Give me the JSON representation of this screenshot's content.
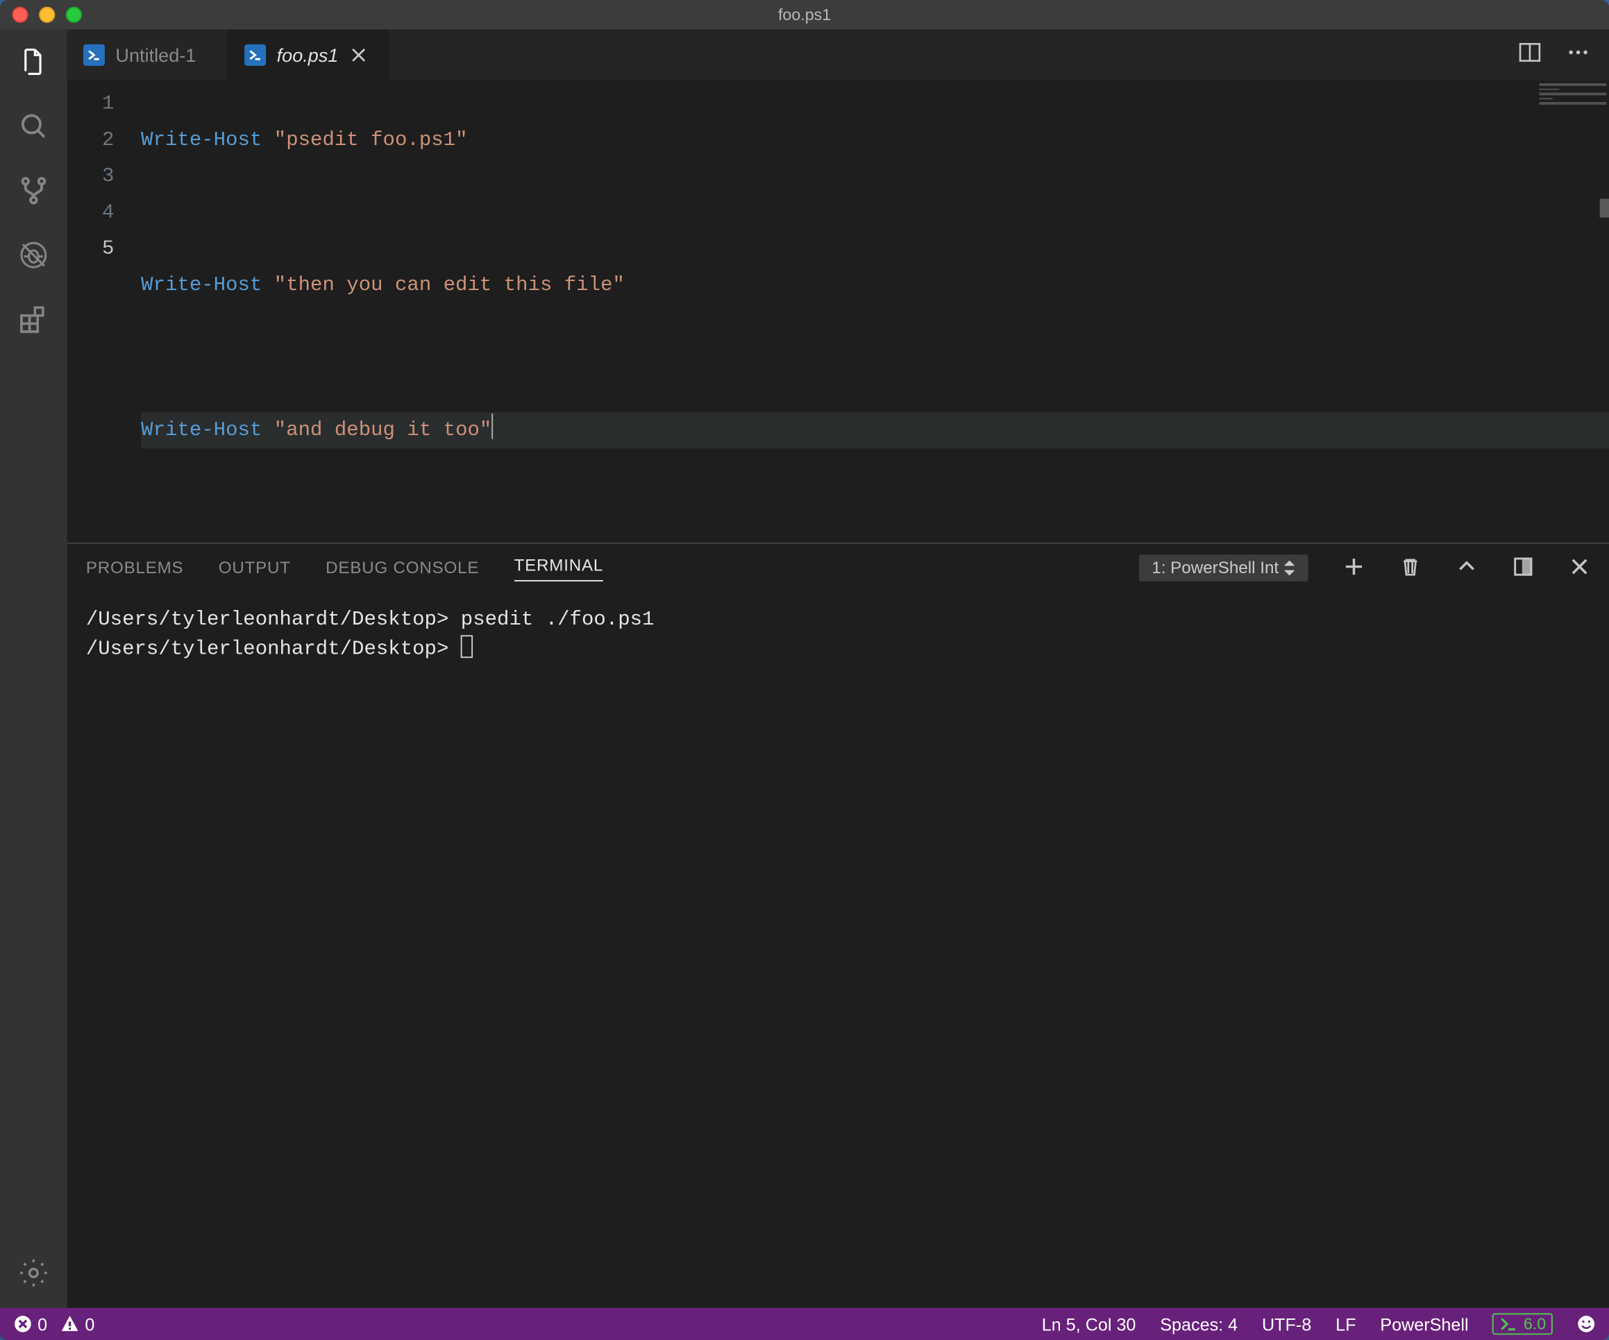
{
  "window": {
    "title": "foo.ps1"
  },
  "tabs": [
    {
      "label": "Untitled-1",
      "active": false
    },
    {
      "label": "foo.ps1",
      "active": true
    }
  ],
  "code": {
    "line_numbers": [
      "1",
      "2",
      "3",
      "4",
      "5"
    ],
    "current_line_index": 4,
    "lines": [
      {
        "kw": "Write-Host",
        "str": "\"psedit foo.ps1\"",
        "blank": false
      },
      {
        "blank": true
      },
      {
        "kw": "Write-Host",
        "str": "\"then you can edit this file\"",
        "blank": false
      },
      {
        "blank": true
      },
      {
        "kw": "Write-Host",
        "str": "\"and debug it too\"",
        "blank": false
      }
    ]
  },
  "panel": {
    "tabs": {
      "problems": "PROBLEMS",
      "output": "OUTPUT",
      "debug_console": "DEBUG CONSOLE",
      "terminal": "TERMINAL"
    },
    "terminal_selector": "1: PowerShell Int",
    "terminal_lines": [
      "/Users/tylerleonhardt/Desktop> psedit ./foo.ps1",
      "/Users/tylerleonhardt/Desktop> "
    ]
  },
  "status": {
    "errors": "0",
    "warnings": "0",
    "cursor_pos": "Ln 5, Col 30",
    "indent": "Spaces: 4",
    "encoding": "UTF-8",
    "eol": "LF",
    "language": "PowerShell",
    "powershell_version": "6.0"
  }
}
